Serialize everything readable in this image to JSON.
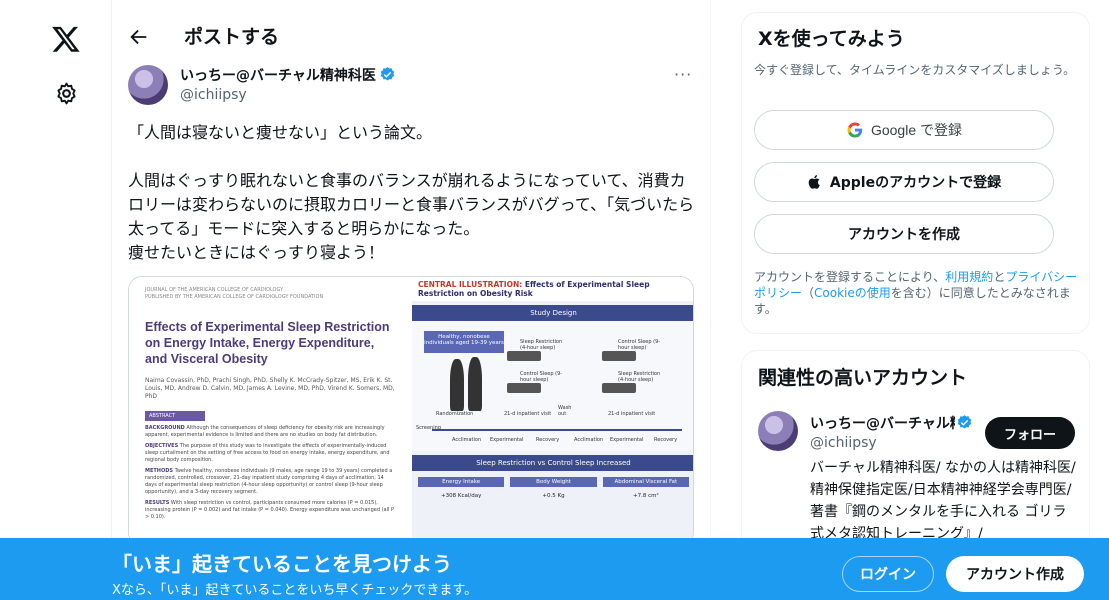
{
  "nav": {
    "logo_icon": "x-logo-icon",
    "settings_icon": "gear-icon"
  },
  "header": {
    "back_icon": "arrow-left-icon",
    "title": "ポストする"
  },
  "post": {
    "author_name": "いっちー@バーチャル精神科医",
    "author_handle": "@ichiipsy",
    "more_label": "···",
    "text": "「人間は寝ないと痩せない」という論文。\n\n人間はぐっすり眠れないと食事のバランスが崩れるようになっていて、消費カロリーは変わらないのに摂取カロリーと食事バランスがバグって、「気づいたら太ってる」モードに突入すると明らかになった。\n痩せたいときにはぐっすり寝よう！"
  },
  "media": {
    "paper": {
      "journal_line1": "JOURNAL OF THE AMERICAN COLLEGE OF CARDIOLOGY",
      "journal_line2": "PUBLISHED BY THE AMERICAN COLLEGE OF CARDIOLOGY FOUNDATION",
      "title": "Effects of Experimental Sleep Restriction on Energy Intake, Energy Expenditure, and Visceral Obesity",
      "authors": "Naima Covassin, PhD, Prachi Singh, PhD, Shelly K. McCrady-Spitzer, MS, Erik K. St. Louis, MD, Andrew D. Calvin, MD, James A. Levine, MD, PhD, Virend K. Somers, MD, PhD",
      "abstract_label": "ABSTRACT",
      "abstract_bg_label": "BACKGROUND",
      "abstract_bg_text": "Although the consequences of sleep deficiency for obesity risk are increasingly apparent, experimental evidence is limited and there are no studies on body fat distribution.",
      "abstract_obj_label": "OBJECTIVES",
      "abstract_obj_text": "The purpose of this study was to investigate the effects of experimentally-induced sleep curtailment on the setting of free access to food on energy intake, energy expenditure, and regional body composition.",
      "abstract_meth_label": "METHODS",
      "abstract_meth_text": "Twelve healthy, nonobese individuals (9 males, age range 19 to 39 years) completed a randomized, controlled, crossover, 21-day inpatient study comprising 4 days of acclimation, 14 days of experimental sleep restriction (4-hour sleep opportunity) or control sleep (9-hour sleep opportunity), and a 3-day recovery segment.",
      "abstract_res_label": "RESULTS",
      "abstract_res_text": "With sleep restriction vs control, participants consumed more calories (P = 0.015), increasing protein (P = 0.002) and fat intake (P = 0.040). Energy expenditure was unchanged (all P > 0.10)."
    },
    "illustration": {
      "title_prefix": "CENTRAL ILLUSTRATION:",
      "title_rest": "Effects of Experimental Sleep Restriction on Obesity Risk",
      "study_design": "Study Design",
      "participants": "Healthy, nonobese individuals aged 19-39 years",
      "arm1": "Sleep Restriction (4-hour sleep)",
      "arm2": "Control Sleep (9-hour sleep)",
      "arm3": "Control Sleep (9-hour sleep)",
      "arm4": "Sleep Restriction (4-hour sleep)",
      "randomization": "Randomization",
      "visit": "21-d inpatient visit",
      "washout": "Wash out",
      "screening": "Screening",
      "phase1": "Acclimation",
      "phase2": "Experimental",
      "phase3": "Recovery",
      "section2": "Sleep Restriction vs Control Sleep Increased",
      "metric1": "Energy Intake",
      "metric2": "Body Weight",
      "metric3": "Abdominal Visceral Fat",
      "value1": "+308 Kcal/day",
      "value2": "+0.5 Kg",
      "value3": "+7.8 cm²"
    }
  },
  "signup_card": {
    "title": "Xを使ってみよう",
    "subtitle": "今すぐ登録して、タイムラインをカスタマイズしましょう。",
    "google_label": "Google で登録",
    "apple_label": "Appleのアカウントで登録",
    "create_label": "アカウントを作成",
    "terms_prefix": "アカウントを登録することにより、",
    "terms_link": "利用規約",
    "terms_and": "と",
    "privacy_link": "プライバシーポリシー",
    "cookie_open": "（",
    "cookie_link": "Cookieの使用",
    "cookie_rest": "を含む）に同意したとみなされます。"
  },
  "related": {
    "title": "関連性の高いアカウント",
    "name": "いっちー@バーチャル精神科医",
    "handle": "@ichiipsy",
    "follow_label": "フォロー",
    "bio": "バーチャル精神科医/ なかの人は精神科医/精神保健指定医/日本精神神経学会専門医/著書『鋼のメンタルを手に入れる ゴリラ式メタ認知トレーニング』/"
  },
  "banner": {
    "title": "「いま」起きていることを見つけよう",
    "subtitle": "Xなら、「いま」起きていることをいち早くチェックできます。",
    "login_label": "ログイン",
    "signup_label": "アカウント作成"
  },
  "colors": {
    "accent": "#1d9bf0",
    "text": "#0f1419",
    "muted": "#536471"
  }
}
